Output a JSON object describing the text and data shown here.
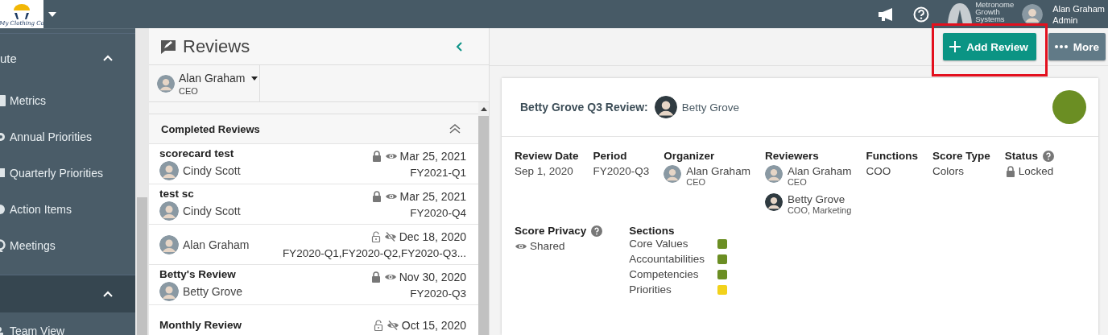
{
  "topbar": {
    "logo_text": "My Clothing Co",
    "brand_lines": [
      "Metronome",
      "Growth",
      "Systems"
    ],
    "user": {
      "name": "Alan Graham",
      "role": "Admin"
    }
  },
  "sidebar": {
    "sections": [
      {
        "title": "ute",
        "expanded": true,
        "items": [
          {
            "label": "Metrics"
          },
          {
            "label": "Annual Priorities"
          },
          {
            "label": "Quarterly Priorities"
          },
          {
            "label": "Action Items"
          },
          {
            "label": "Meetings"
          }
        ]
      },
      {
        "expanded": true,
        "items": [
          {
            "label": "Team View"
          }
        ]
      }
    ]
  },
  "reviews": {
    "title": "Reviews",
    "person": {
      "name": "Alan Graham",
      "role": "CEO"
    },
    "group": {
      "title": "Completed Reviews",
      "expanded": true
    },
    "rows": [
      {
        "title": "scorecard test",
        "person": "Cindy Scott",
        "locked": true,
        "shared": true,
        "date": "Mar 25, 2021",
        "period": "FY2021-Q1"
      },
      {
        "title": "test sc",
        "person": "Cindy Scott",
        "locked": true,
        "shared": true,
        "date": "Mar 25, 2021",
        "period": "FY2020-Q4"
      },
      {
        "person": "Alan Graham",
        "locked": false,
        "shared": false,
        "date": "Dec 18, 2020",
        "period": "FY2020-Q1,FY2020-Q2,FY2020-Q3..."
      },
      {
        "title": "Betty's Review",
        "person": "Betty Grove",
        "locked": true,
        "shared": true,
        "date": "Nov 30, 2020",
        "period": "FY2020-Q3"
      },
      {
        "title": "Monthly Review",
        "locked": false,
        "shared": false,
        "date": "Oct 15, 2020"
      }
    ]
  },
  "toolbar": {
    "buttons": [
      {
        "label": "Add Review",
        "kind": "add"
      },
      {
        "label": "More",
        "kind": "more"
      }
    ]
  },
  "card": {
    "title": "Betty Grove Q3 Review:",
    "subject": "Betty Grove",
    "color": "#6b8e23",
    "fields": [
      {
        "label": "Review Date",
        "kind": "text",
        "value": "Sep 1, 2020"
      },
      {
        "label": "Period",
        "kind": "text",
        "value": "FY2020-Q3"
      },
      {
        "label": "Organizer",
        "kind": "people",
        "people": [
          {
            "name": "Alan Graham",
            "role": "CEO"
          }
        ]
      },
      {
        "label": "Reviewers",
        "kind": "people",
        "people": [
          {
            "name": "Alan Graham",
            "role": "CEO"
          },
          {
            "name": "Betty Grove",
            "role": "COO, Marketing"
          }
        ]
      },
      {
        "label": "Functions",
        "kind": "text",
        "value": "COO"
      },
      {
        "label": "Score Type",
        "kind": "text",
        "value": "Colors"
      },
      {
        "label": "Status",
        "kind": "status",
        "help": true,
        "locked": true,
        "value": "Locked"
      }
    ],
    "privacy": {
      "label": "Score Privacy",
      "help": true,
      "shared": true,
      "value": "Shared"
    },
    "sections": {
      "label": "Sections",
      "items": [
        {
          "name": "Core Values",
          "color": "#6b8e23"
        },
        {
          "name": "Accountabilities",
          "color": "#6b8e23"
        },
        {
          "name": "Competencies",
          "color": "#6b8e23"
        },
        {
          "name": "Priorities",
          "color": "#f2d21b"
        }
      ]
    }
  }
}
